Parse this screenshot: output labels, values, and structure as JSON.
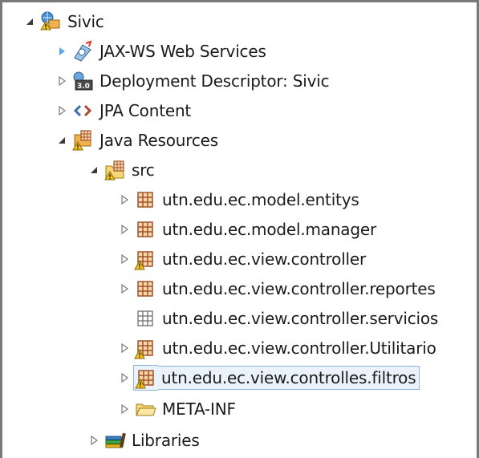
{
  "tree": {
    "project": {
      "label": "Sivic"
    },
    "jaxws": {
      "label": "JAX-WS Web Services"
    },
    "deployment": {
      "label": "Deployment Descriptor: Sivic"
    },
    "jpa": {
      "label": "JPA Content"
    },
    "java_resources": {
      "label": "Java Resources"
    },
    "src": {
      "label": "src"
    },
    "packages": [
      {
        "label": "utn.edu.ec.model.entitys",
        "state": "collapsed",
        "warning": false,
        "empty": false,
        "selected": false
      },
      {
        "label": "utn.edu.ec.model.manager",
        "state": "collapsed",
        "warning": false,
        "empty": false,
        "selected": false
      },
      {
        "label": "utn.edu.ec.view.controller",
        "state": "collapsed",
        "warning": true,
        "empty": false,
        "selected": false
      },
      {
        "label": "utn.edu.ec.view.controller.reportes",
        "state": "collapsed",
        "warning": false,
        "empty": false,
        "selected": false
      },
      {
        "label": "utn.edu.ec.view.controller.servicios",
        "state": "none",
        "warning": false,
        "empty": true,
        "selected": false
      },
      {
        "label": "utn.edu.ec.view.controller.Utilitario",
        "state": "collapsed",
        "warning": true,
        "empty": false,
        "selected": false
      },
      {
        "label": "utn.edu.ec.view.controlles.filtros",
        "state": "collapsed",
        "warning": true,
        "empty": false,
        "selected": true
      }
    ],
    "meta_inf": {
      "label": "META-INF"
    },
    "libraries": {
      "label": "Libraries"
    }
  },
  "icons": {
    "expanded": "expanded-triangle-icon",
    "collapsed": "collapsed-triangle-icon",
    "package": "package-icon",
    "warning": "warning-overlay-icon"
  },
  "colors": {
    "package_brown": "#a0522d",
    "package_fill": "#f6d7a8",
    "warning_yellow": "#f2c21b",
    "selection_border": "#8fb3d9",
    "selection_fill": "#eaf2fb"
  }
}
